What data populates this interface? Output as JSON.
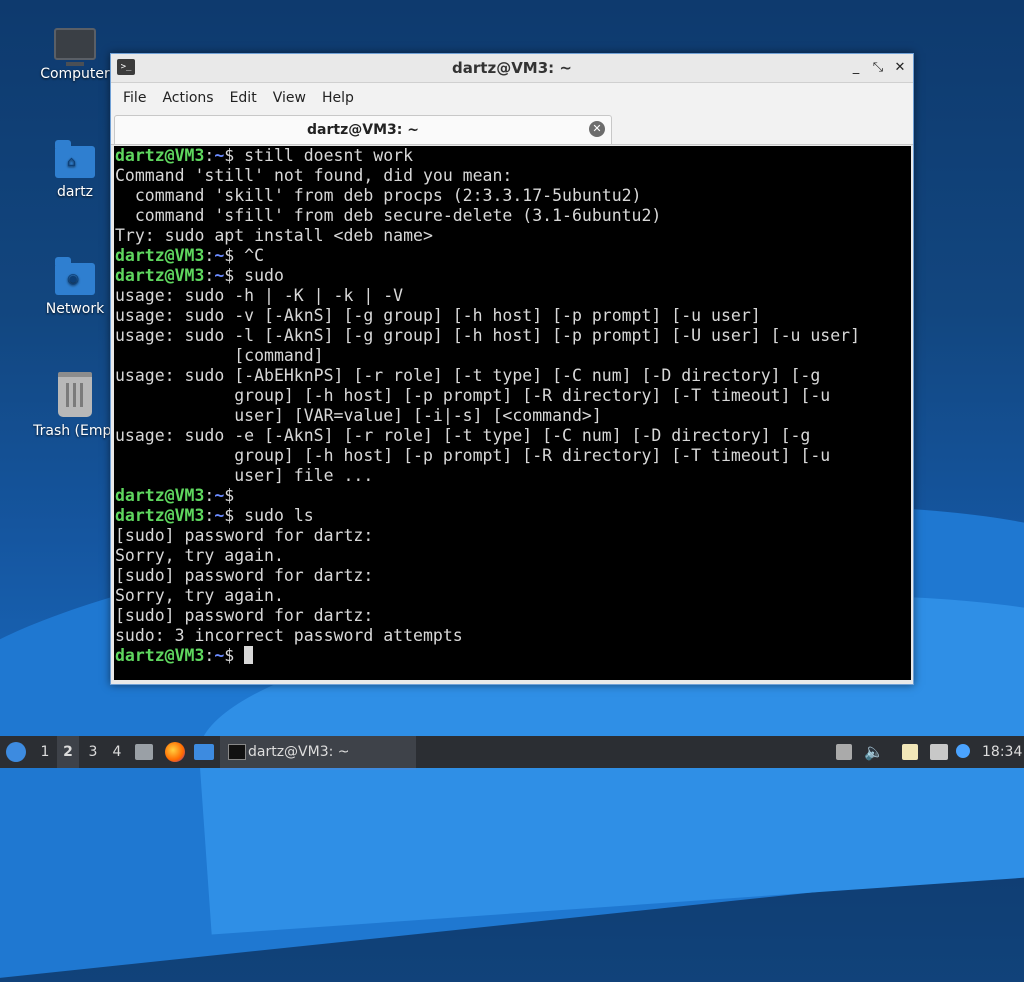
{
  "desktop": {
    "icons": [
      {
        "label": "Computer",
        "icon": "computer-icon"
      },
      {
        "label": "dartz",
        "icon": "home-folder-icon"
      },
      {
        "label": "Network",
        "icon": "network-folder-icon"
      },
      {
        "label": "Trash (Empt",
        "icon": "trash-icon"
      }
    ]
  },
  "window": {
    "title": "dartz@VM3: ~",
    "controls": {
      "minimize": "_",
      "maximize": "⤡",
      "close": "✕"
    },
    "menu": [
      "File",
      "Edit",
      "View",
      "Help"
    ],
    "menu_full": [
      "File",
      "Actions",
      "Edit",
      "View",
      "Help"
    ],
    "tab_label": "dartz@VM3: ~",
    "tab_close": "✕"
  },
  "terminal": {
    "prompt_user": "dartz@VM3",
    "prompt_path": "~",
    "lines": [
      {
        "type": "prompt",
        "cmd": "still doesnt work"
      },
      {
        "type": "out",
        "text": "Command 'still' not found, did you mean:"
      },
      {
        "type": "out",
        "text": "  command 'skill' from deb procps (2:3.3.17-5ubuntu2)"
      },
      {
        "type": "out",
        "text": "  command 'sfill' from deb secure-delete (3.1-6ubuntu2)"
      },
      {
        "type": "out",
        "text": "Try: sudo apt install <deb name>"
      },
      {
        "type": "prompt",
        "cmd": "^C"
      },
      {
        "type": "prompt",
        "cmd": "sudo"
      },
      {
        "type": "out",
        "text": "usage: sudo -h | -K | -k | -V"
      },
      {
        "type": "out",
        "text": "usage: sudo -v [-AknS] [-g group] [-h host] [-p prompt] [-u user]"
      },
      {
        "type": "out",
        "text": "usage: sudo -l [-AknS] [-g group] [-h host] [-p prompt] [-U user] [-u user]"
      },
      {
        "type": "out",
        "text": "            [command]"
      },
      {
        "type": "out",
        "text": "usage: sudo [-AbEHknPS] [-r role] [-t type] [-C num] [-D directory] [-g"
      },
      {
        "type": "out",
        "text": "            group] [-h host] [-p prompt] [-R directory] [-T timeout] [-u"
      },
      {
        "type": "out",
        "text": "            user] [VAR=value] [-i|-s] [<command>]"
      },
      {
        "type": "out",
        "text": "usage: sudo -e [-AknS] [-r role] [-t type] [-C num] [-D directory] [-g"
      },
      {
        "type": "out",
        "text": "            group] [-h host] [-p prompt] [-R directory] [-T timeout] [-u"
      },
      {
        "type": "out",
        "text": "            user] file ..."
      },
      {
        "type": "prompt",
        "cmd": ""
      },
      {
        "type": "prompt",
        "cmd": "sudo ls"
      },
      {
        "type": "out",
        "text": "[sudo] password for dartz:"
      },
      {
        "type": "out",
        "text": "Sorry, try again."
      },
      {
        "type": "out",
        "text": "[sudo] password for dartz:"
      },
      {
        "type": "out",
        "text": "Sorry, try again."
      },
      {
        "type": "out",
        "text": "[sudo] password for dartz:"
      },
      {
        "type": "out",
        "text": "sudo: 3 incorrect password attempts"
      },
      {
        "type": "prompt",
        "cmd": "",
        "cursor": true
      }
    ]
  },
  "taskbar": {
    "workspaces": [
      "1",
      "2",
      "3",
      "4"
    ],
    "active_workspace": "2",
    "launchers": [
      "file-manager-icon",
      "firefox-icon",
      "desktop-icon"
    ],
    "task_label": "dartz@VM3: ~",
    "tray_icons": [
      "removable-media-icon",
      "volume-icon",
      "clipboard-icon",
      "network-icon",
      "updates-icon"
    ],
    "clock": "18:34"
  },
  "colors": {
    "prompt_user": "#5fd75f",
    "prompt_path": "#6c8cff",
    "terminal_bg": "#000000",
    "terminal_fg": "#d8d8d8",
    "accent": "#3d8be0"
  }
}
